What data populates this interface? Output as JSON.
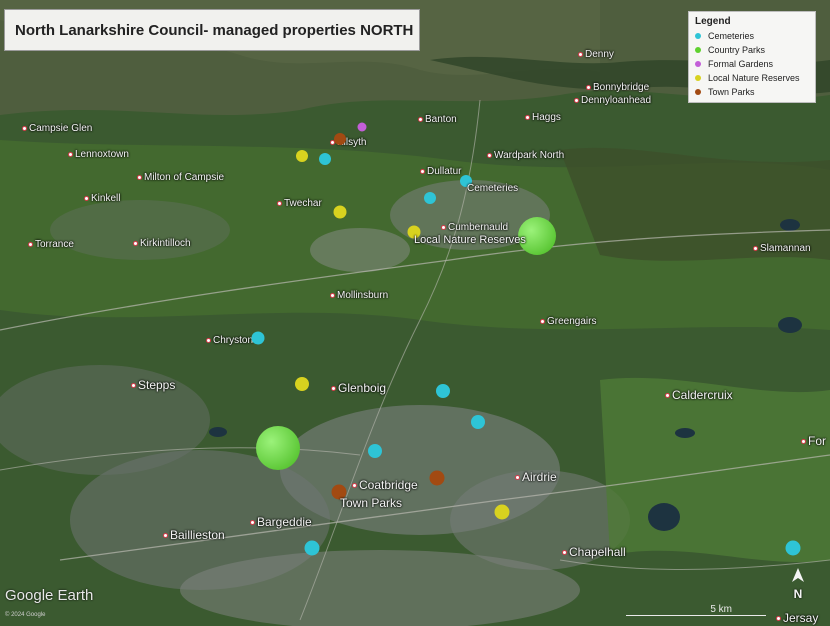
{
  "title": "North Lanarkshire Council- managed properties NORTH",
  "legend": {
    "heading": "Legend",
    "items": [
      {
        "label": "Cemeteries",
        "color": "#2ec4d6"
      },
      {
        "label": "Country Parks",
        "color": "#5fd12f"
      },
      {
        "label": "Formal Gardens",
        "color": "#c35fd8"
      },
      {
        "label": "Local Nature Reserves",
        "color": "#d8d21f"
      },
      {
        "label": "Town Parks",
        "color": "#a24a12"
      }
    ]
  },
  "towns": [
    {
      "name": "Denny"
    },
    {
      "name": "Bonnybridge"
    },
    {
      "name": "Dennyloanhead"
    },
    {
      "name": "Haggs"
    },
    {
      "name": "Banton"
    },
    {
      "name": "Campsie Glen"
    },
    {
      "name": "Kilsyth"
    },
    {
      "name": "Lennoxtown"
    },
    {
      "name": "Wardpark North"
    },
    {
      "name": "Dullatur"
    },
    {
      "name": "Milton of Campsie"
    },
    {
      "name": "Kirkintilloch"
    },
    {
      "name": "Kinkell"
    },
    {
      "name": "Twechar"
    },
    {
      "name": "Cumbernauld"
    },
    {
      "name": "Torrance"
    },
    {
      "name": "Slamannan"
    },
    {
      "name": "Mollinsburn"
    },
    {
      "name": "Greengairs"
    },
    {
      "name": "Chryston"
    },
    {
      "name": "Stepps"
    },
    {
      "name": "Glenboig"
    },
    {
      "name": "Caldercruix"
    },
    {
      "name": "Airdrie"
    },
    {
      "name": "Coatbridge"
    },
    {
      "name": "Bargeddie"
    },
    {
      "name": "Baillieston"
    },
    {
      "name": "Chapelhall"
    },
    {
      "name": "Jersay"
    },
    {
      "name": "For"
    }
  ],
  "map_labels": {
    "cemeteries": "Cemeteries",
    "local_nature_reserves": "Local Nature Reserves",
    "town_parks": "Town Parks"
  },
  "scale": {
    "label": "5 km"
  },
  "north_letter": "N",
  "watermark": "Google Earth",
  "copyright": "© 2024 Google"
}
